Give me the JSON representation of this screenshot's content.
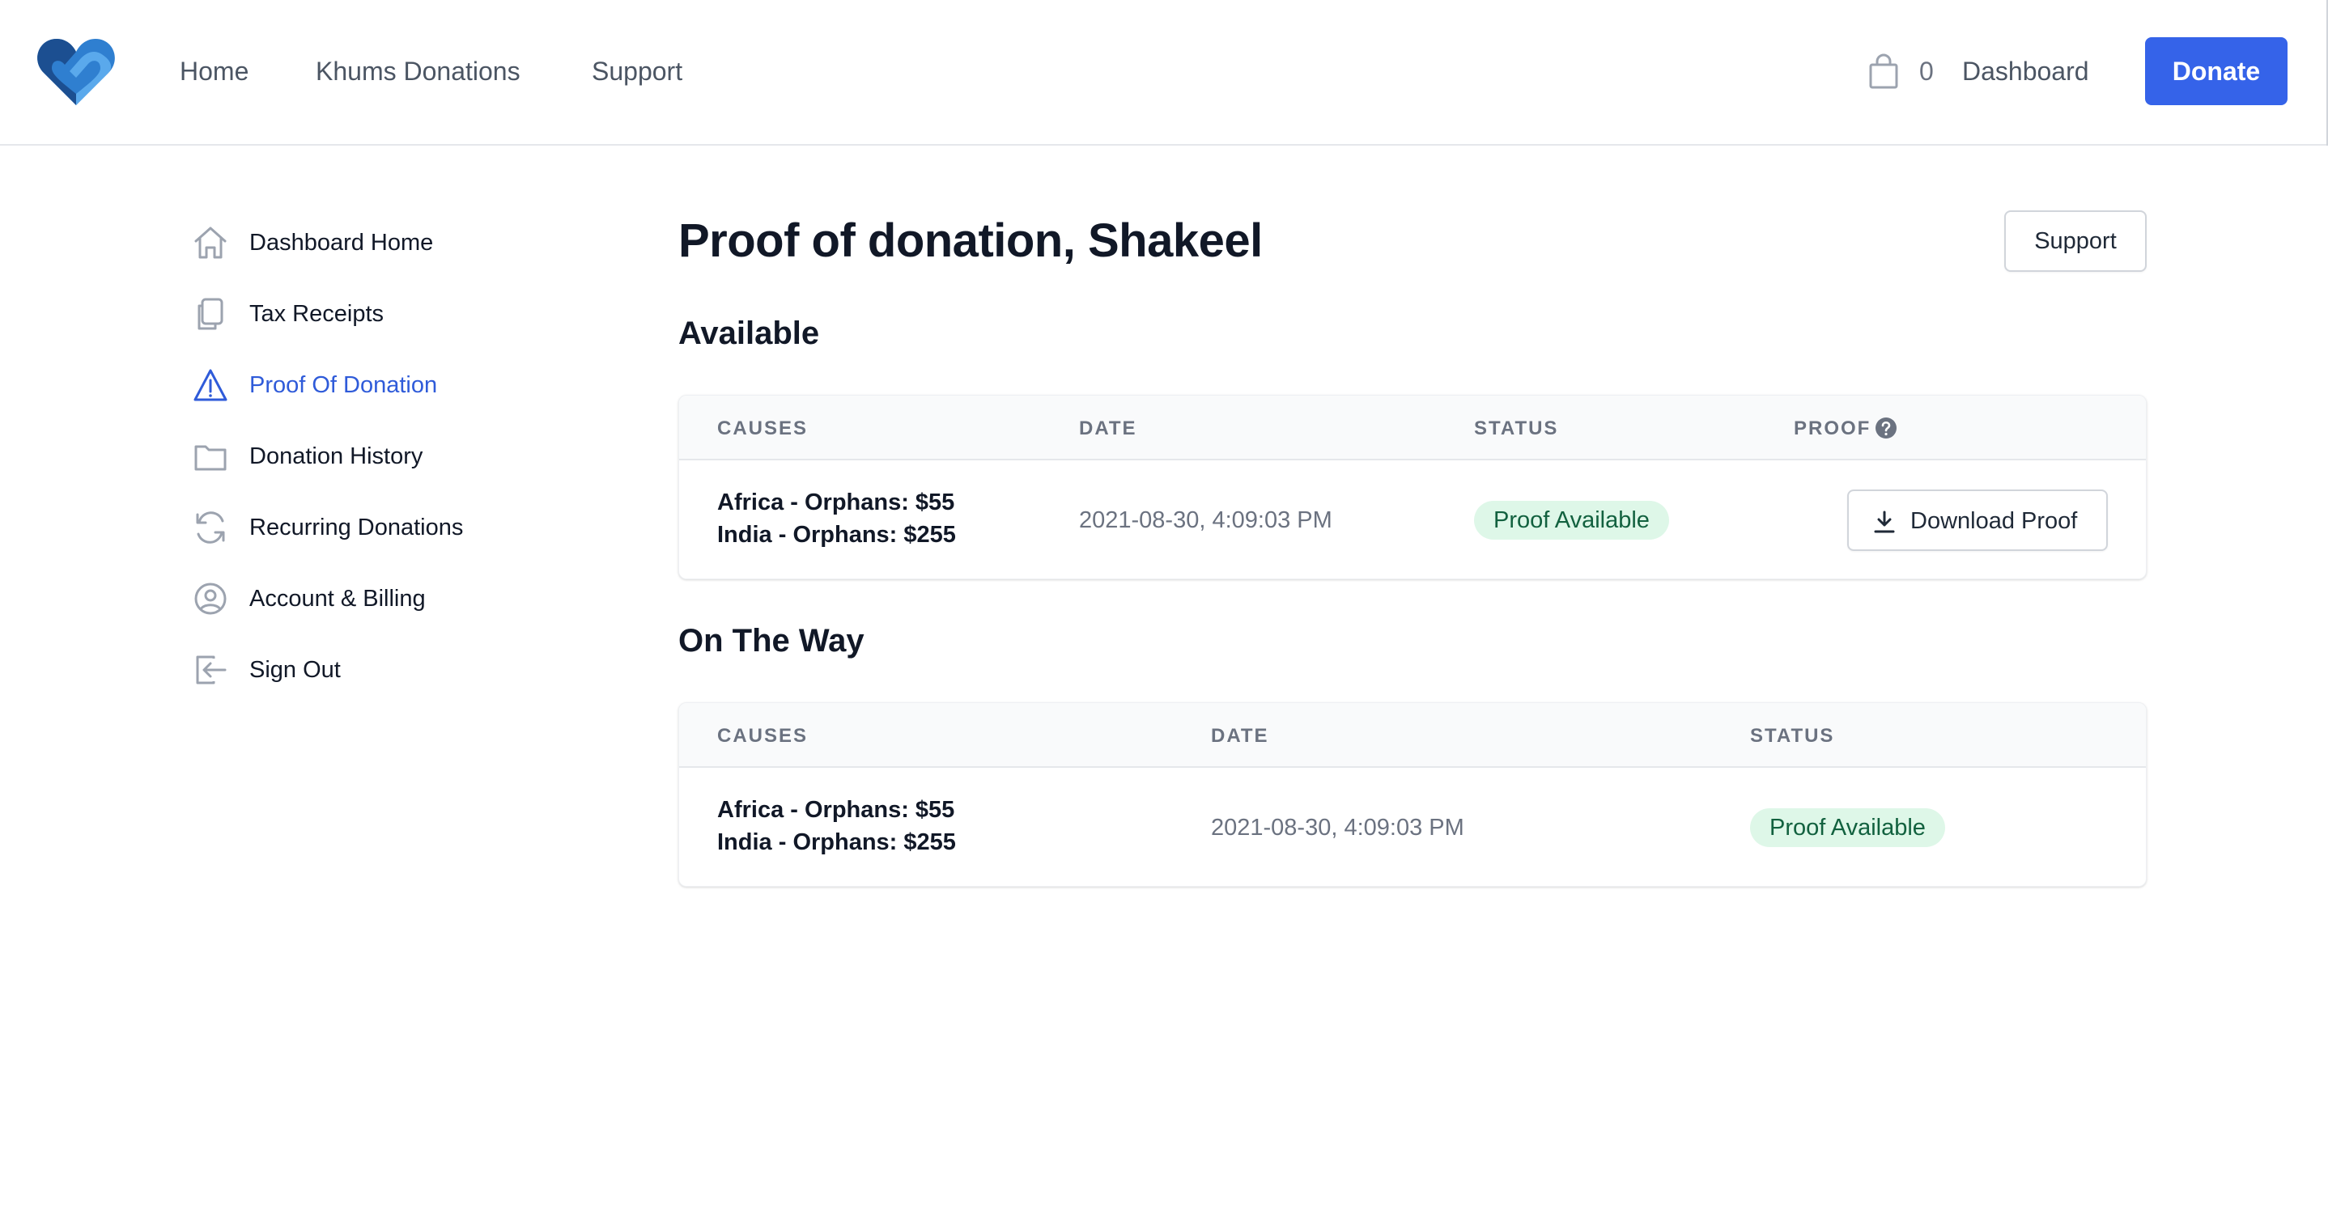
{
  "header": {
    "nav": [
      {
        "label": "Home"
      },
      {
        "label": "Khums Donations"
      },
      {
        "label": "Support"
      }
    ],
    "cart_count": "0",
    "dashboard_label": "Dashboard",
    "donate_label": "Donate",
    "brand_color": "#3563e9"
  },
  "sidebar": {
    "items": [
      {
        "label": "Dashboard Home",
        "icon": "home-icon"
      },
      {
        "label": "Tax Receipts",
        "icon": "documents-icon"
      },
      {
        "label": "Proof Of Donation",
        "icon": "warning-triangle-icon",
        "active": true
      },
      {
        "label": "Donation History",
        "icon": "folder-icon"
      },
      {
        "label": "Recurring Donations",
        "icon": "refresh-icon"
      },
      {
        "label": "Account & Billing",
        "icon": "user-circle-icon"
      },
      {
        "label": "Sign Out",
        "icon": "sign-out-icon"
      }
    ]
  },
  "main": {
    "title": "Proof of donation, Shakeel",
    "support_label": "Support",
    "available": {
      "title": "Available",
      "headers": [
        "Causes",
        "Date",
        "Status",
        "Proof"
      ],
      "rows": [
        {
          "causes": [
            "Africa - Orphans: $55",
            "India - Orphans: $255"
          ],
          "date": "2021-08-30, 4:09:03 PM",
          "status": "Proof Available",
          "action": "Download Proof"
        }
      ]
    },
    "on_the_way": {
      "title": "On The Way",
      "headers": [
        "Causes",
        "Date",
        "Status"
      ],
      "rows": [
        {
          "causes": [
            "Africa - Orphans: $55",
            "India - Orphans: $255"
          ],
          "date": "2021-08-30, 4:09:03 PM",
          "status": "Proof Available"
        }
      ]
    }
  }
}
